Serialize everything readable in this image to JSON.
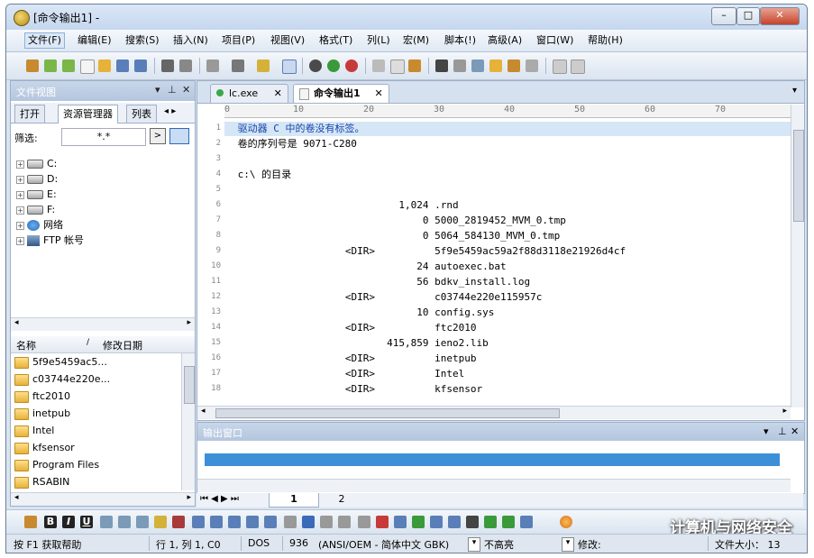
{
  "window": {
    "title": "[命令输出1] -"
  },
  "menu": [
    "文件(F)",
    "编辑(E)",
    "搜索(S)",
    "插入(N)",
    "项目(P)",
    "视图(V)",
    "格式(T)",
    "列(L)",
    "宏(M)",
    "脚本(!)",
    "高级(A)",
    "窗口(W)",
    "帮助(H)"
  ],
  "left_panel": {
    "title": "文件视图",
    "tabs": [
      "打开",
      "资源管理器",
      "列表"
    ],
    "filter_label": "筛选:",
    "filter_value": "*.*",
    "tree": [
      "C:",
      "D:",
      "E:",
      "F:",
      "网络",
      "FTP 帐号"
    ],
    "list_headers": [
      "名称",
      "修改日期"
    ],
    "files": [
      "5f9e5459ac5...",
      "c03744e220e...",
      "ftc2010",
      "inetpub",
      "Intel",
      "kfsensor",
      "Program Files",
      "RSABIN"
    ]
  },
  "editor": {
    "tabs": [
      "lc.exe",
      "命令输出1"
    ],
    "ruler": [
      "0",
      "10",
      "20",
      "30",
      "40",
      "50",
      "60",
      "70"
    ],
    "lines": [
      " 驱动器 C 中的卷没有标签。",
      " 卷的序列号是 9071-C280",
      "",
      " c:\\ 的目录",
      "",
      "                            1,024 .rnd",
      "                                0 5000_2819452_MVM_0.tmp",
      "                                0 5064_584130_MVM_0.tmp",
      "                   <DIR>          5f9e5459ac59a2f88d3118e21926d4cf",
      "                               24 autoexec.bat",
      "                               56 bdkv_install.log",
      "                   <DIR>          c03744e220e115957c",
      "                               10 config.sys",
      "                   <DIR>          ftc2010",
      "                          415,859 ieno2.lib",
      "                   <DIR>          inetpub",
      "                   <DIR>          Intel",
      "                   <DIR>          kfsensor"
    ]
  },
  "output": {
    "title": "输出窗口"
  },
  "pages": [
    "1",
    "2"
  ],
  "status": {
    "help": "按 F1 获取帮助",
    "position": "行 1, 列 1, C0",
    "format": "DOS",
    "codepage": "936",
    "encoding": "(ANSI/OEM - 简体中文 GBK)",
    "highlight": "不高亮",
    "modified_label": "修改:",
    "filesize": "文件大小： 13"
  },
  "watermark": "计算机与网络安全"
}
